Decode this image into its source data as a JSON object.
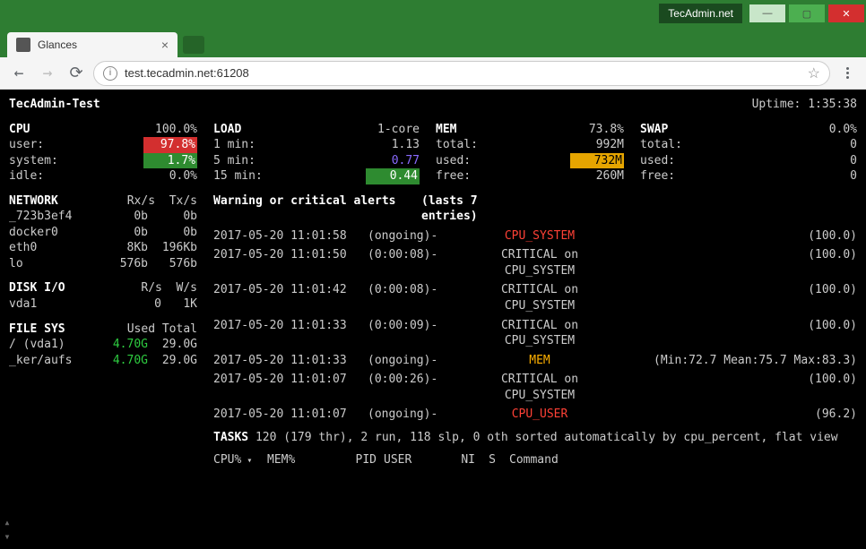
{
  "window": {
    "brand": "TecAdmin.net"
  },
  "browser": {
    "tab_title": "Glances",
    "url": "test.tecadmin.net:61208"
  },
  "host": {
    "name": "TecAdmin-Test",
    "uptime_label": "Uptime:",
    "uptime": "1:35:38"
  },
  "cpu": {
    "title": "CPU",
    "total": "100.0%",
    "rows": [
      {
        "k": "user:",
        "v": "97.8%",
        "cls": "bg-red"
      },
      {
        "k": "system:",
        "v": "1.7%",
        "cls": "bg-green"
      },
      {
        "k": "idle:",
        "v": "0.0%",
        "cls": ""
      }
    ]
  },
  "load": {
    "title": "LOAD",
    "core": "1-core",
    "rows": [
      {
        "k": "1 min:",
        "v": "1.13",
        "cls": ""
      },
      {
        "k": "5 min:",
        "v": "0.77",
        "cls": "fg-violet"
      },
      {
        "k": "15 min:",
        "v": "0.44",
        "cls": "bg-green"
      }
    ]
  },
  "mem": {
    "title": "MEM",
    "pct": "73.8%",
    "rows": [
      {
        "k": "total:",
        "v": "992M",
        "cls": ""
      },
      {
        "k": "used:",
        "v": "732M",
        "cls": "bg-orange"
      },
      {
        "k": "free:",
        "v": "260M",
        "cls": ""
      }
    ]
  },
  "swap": {
    "title": "SWAP",
    "pct": "0.0%",
    "rows": [
      {
        "k": "total:",
        "v": "0",
        "cls": ""
      },
      {
        "k": "used:",
        "v": "0",
        "cls": ""
      },
      {
        "k": "free:",
        "v": "0",
        "cls": ""
      }
    ]
  },
  "network": {
    "title": "NETWORK",
    "h1": "Rx/s",
    "h2": "Tx/s",
    "rows": [
      {
        "n": "_723b3ef4",
        "rx": "0b",
        "tx": "0b"
      },
      {
        "n": "docker0",
        "rx": "0b",
        "tx": "0b"
      },
      {
        "n": "eth0",
        "rx": "8Kb",
        "tx": "196Kb"
      },
      {
        "n": "lo",
        "rx": "576b",
        "tx": "576b"
      }
    ]
  },
  "diskio": {
    "title": "DISK I/O",
    "h1": "R/s",
    "h2": "W/s",
    "rows": [
      {
        "n": "vda1",
        "r": "0",
        "w": "1K"
      }
    ]
  },
  "fs": {
    "title": "FILE SYS",
    "h1": "Used",
    "h2": "Total",
    "rows": [
      {
        "n": "/ (vda1)",
        "u": "4.70G",
        "t": "29.0G"
      },
      {
        "n": "_ker/aufs",
        "u": "4.70G",
        "t": "29.0G"
      }
    ]
  },
  "alerts": {
    "title1": "Warning or critical alerts",
    "title2": "(lasts 7 entries)",
    "rows": [
      {
        "ts": "2017-05-20 11:01:58",
        "dur": "(ongoing)-",
        "lbl": "CPU_SYSTEM",
        "lblcls": "fg-red",
        "val": "(100.0)"
      },
      {
        "ts": "2017-05-20 11:01:50",
        "dur": "(0:00:08)-",
        "lbl": "CRITICAL on CPU_SYSTEM",
        "lblcls": "",
        "val": "(100.0)"
      },
      {
        "ts": "2017-05-20 11:01:42",
        "dur": "(0:00:08)-",
        "lbl": "CRITICAL on CPU_SYSTEM",
        "lblcls": "",
        "val": "(100.0)"
      },
      {
        "ts": "2017-05-20 11:01:33",
        "dur": "(0:00:09)-",
        "lbl": "CRITICAL on CPU_SYSTEM",
        "lblcls": "",
        "val": "(100.0)"
      },
      {
        "ts": "2017-05-20 11:01:33",
        "dur": "(ongoing)-",
        "lbl": "MEM",
        "lblcls": "fg-orange",
        "val": "(Min:72.7 Mean:75.7 Max:83.3)"
      },
      {
        "ts": "2017-05-20 11:01:07",
        "dur": "(0:00:26)-",
        "lbl": "CRITICAL on CPU_SYSTEM",
        "lblcls": "",
        "val": "(100.0)"
      },
      {
        "ts": "2017-05-20 11:01:07",
        "dur": "(ongoing)-",
        "lbl": "CPU_USER",
        "lblcls": "fg-red",
        "val": "(96.2)"
      }
    ]
  },
  "tasks": {
    "label": "TASKS",
    "text": "120 (179 thr), 2 run, 118 slp, 0 oth sorted automatically by cpu_percent, flat view"
  },
  "proc_head": [
    "CPU%",
    "MEM%",
    "PID",
    "USER",
    "NI",
    "S",
    "Command"
  ]
}
